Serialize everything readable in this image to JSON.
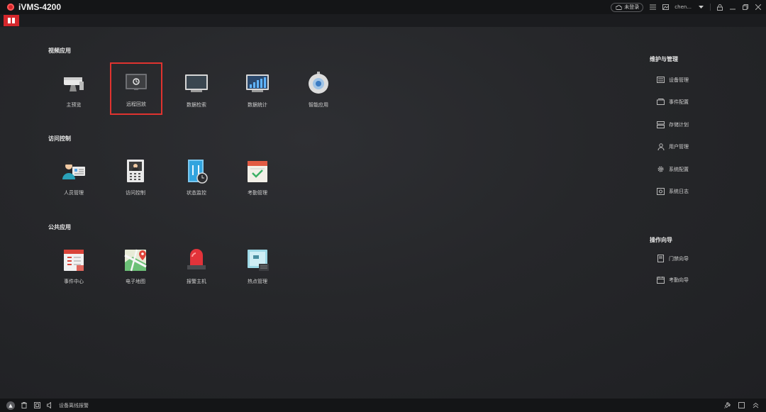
{
  "window": {
    "title": "iVMS-4200"
  },
  "titlebar": {
    "login_status": "未登录",
    "user": "chen...",
    "icons": [
      "cloud-icon",
      "list-icon",
      "image-icon",
      "lock-icon",
      "minimize-icon",
      "restore-icon",
      "close-icon"
    ]
  },
  "sections": [
    {
      "title": "视频应用",
      "items": [
        {
          "label": "主预览",
          "icon": "camera-icon"
        },
        {
          "label": "远程回放",
          "icon": "playback-icon",
          "selected": true
        },
        {
          "label": "数据检索",
          "icon": "monitor-icon"
        },
        {
          "label": "数据统计",
          "icon": "statistics-icon"
        },
        {
          "label": "智能应用",
          "icon": "dome-camera-icon"
        }
      ]
    },
    {
      "title": "访问控制",
      "items": [
        {
          "label": "人员管理",
          "icon": "person-card-icon"
        },
        {
          "label": "访问控制",
          "icon": "intercom-icon"
        },
        {
          "label": "状态监控",
          "icon": "door-monitor-icon"
        },
        {
          "label": "考勤管理",
          "icon": "calendar-icon"
        }
      ]
    },
    {
      "title": "公共应用",
      "items": [
        {
          "label": "事件中心",
          "icon": "event-icon"
        },
        {
          "label": "电子地图",
          "icon": "map-icon"
        },
        {
          "label": "报警主机",
          "icon": "alarm-light-icon"
        },
        {
          "label": "热点管理",
          "icon": "hotspot-icon"
        }
      ]
    }
  ],
  "right_panel": {
    "maintenance": {
      "title": "维护与管理",
      "items": [
        {
          "label": "设备管理",
          "icon": "device-icon"
        },
        {
          "label": "事件配置",
          "icon": "event-config-icon"
        },
        {
          "label": "存储计划",
          "icon": "storage-icon"
        },
        {
          "label": "用户管理",
          "icon": "user-icon"
        },
        {
          "label": "系统配置",
          "icon": "gear-icon"
        },
        {
          "label": "系统日志",
          "icon": "log-icon"
        }
      ]
    },
    "guide": {
      "title": "操作向导",
      "items": [
        {
          "label": "门禁向导",
          "icon": "door-guide-icon"
        },
        {
          "label": "考勤向导",
          "icon": "attendance-guide-icon"
        }
      ]
    }
  },
  "statusbar": {
    "message": "设备离线报警"
  },
  "colors": {
    "accent": "#d4272c",
    "background": "#26272a",
    "titlebar": "#141517"
  }
}
